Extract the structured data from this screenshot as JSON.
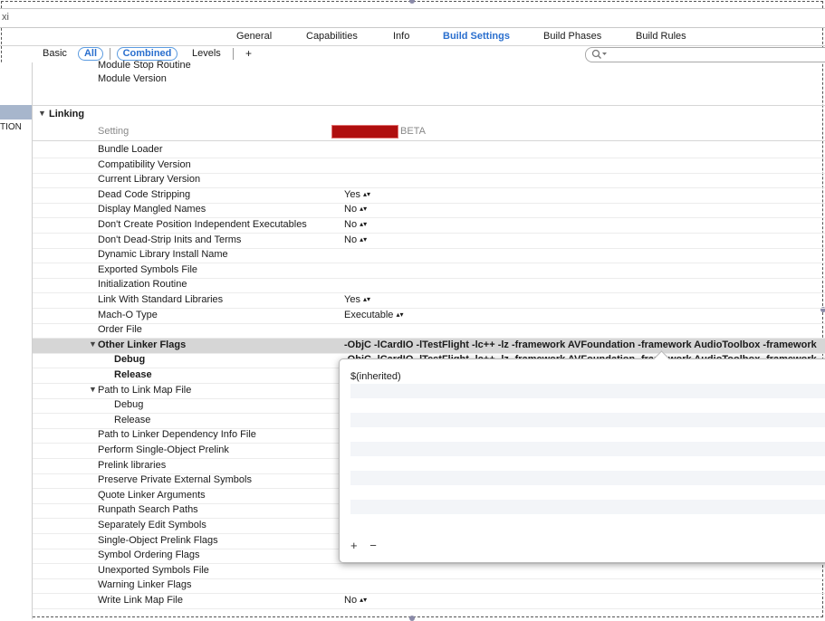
{
  "window": {
    "title_fragment": "xi"
  },
  "tabs": [
    {
      "label": "General",
      "active": false
    },
    {
      "label": "Capabilities",
      "active": false
    },
    {
      "label": "Info",
      "active": false
    },
    {
      "label": "Build Settings",
      "active": true
    },
    {
      "label": "Build Phases",
      "active": false
    },
    {
      "label": "Build Rules",
      "active": false
    }
  ],
  "filter": {
    "basic": "Basic",
    "all": "All",
    "combined": "Combined",
    "levels": "Levels",
    "add": "+",
    "search_placeholder": ""
  },
  "leftnav": {
    "label": "TION"
  },
  "top_rows": [
    {
      "name": "Module Stop Routine",
      "value": ""
    },
    {
      "name": "Module Version",
      "value": ""
    }
  ],
  "section": {
    "title": "Linking",
    "setting_header": "Setting",
    "beta_label": "BETA"
  },
  "rows": [
    {
      "name": "Bundle Loader",
      "value": ""
    },
    {
      "name": "Compatibility Version",
      "value": ""
    },
    {
      "name": "Current Library Version",
      "value": ""
    },
    {
      "name": "Dead Code Stripping",
      "value": "Yes",
      "stepper": true
    },
    {
      "name": "Display Mangled Names",
      "value": "No",
      "stepper": true
    },
    {
      "name": "Don't Create Position Independent Executables",
      "value": "No",
      "stepper": true
    },
    {
      "name": "Don't Dead-Strip Inits and Terms",
      "value": "No",
      "stepper": true
    },
    {
      "name": "Dynamic Library Install Name",
      "value": ""
    },
    {
      "name": "Exported Symbols File",
      "value": ""
    },
    {
      "name": "Initialization Routine",
      "value": ""
    },
    {
      "name": "Link With Standard Libraries",
      "value": "Yes",
      "stepper": true
    },
    {
      "name": "Mach-O Type",
      "value": "Executable",
      "stepper": true
    },
    {
      "name": "Order File",
      "value": ""
    },
    {
      "name": "Other Linker Flags",
      "value": "-ObjC -lCardIO -lTestFlight -lc++ -lz -framework AVFoundation -framework AudioToolbox -framework",
      "bold": true,
      "expanded": true,
      "highlight": true
    },
    {
      "name": "Debug",
      "value": "-ObjC -lCardIO -lTestFlight -lc++ -lz -framework AVFoundation -framework AudioToolbox -framework",
      "bold": true,
      "sub": true
    },
    {
      "name": "Release",
      "value": "",
      "bold": true,
      "sub": true
    },
    {
      "name": "Path to Link Map File",
      "value": "",
      "expanded": true
    },
    {
      "name": "Debug",
      "value": "",
      "sub": true
    },
    {
      "name": "Release",
      "value": "",
      "sub": true
    },
    {
      "name": "Path to Linker Dependency Info File",
      "value": ""
    },
    {
      "name": "Perform Single-Object Prelink",
      "value": ""
    },
    {
      "name": "Prelink libraries",
      "value": ""
    },
    {
      "name": "Preserve Private External Symbols",
      "value": ""
    },
    {
      "name": "Quote Linker Arguments",
      "value": ""
    },
    {
      "name": "Runpath Search Paths",
      "value": ""
    },
    {
      "name": "Separately Edit Symbols",
      "value": ""
    },
    {
      "name": "Single-Object Prelink Flags",
      "value": ""
    },
    {
      "name": "Symbol Ordering Flags",
      "value": ""
    },
    {
      "name": "Unexported Symbols File",
      "value": ""
    },
    {
      "name": "Warning Linker Flags",
      "value": ""
    },
    {
      "name": "Write Link Map File",
      "value": "No",
      "stepper": true
    }
  ],
  "popover": {
    "items": [
      "$(inherited)"
    ],
    "add_label": "+",
    "remove_label": "−"
  },
  "colors": {
    "accent": "#2a6fce",
    "highlight_row": "#d6d6d6",
    "redacted": "#b00e0e"
  }
}
